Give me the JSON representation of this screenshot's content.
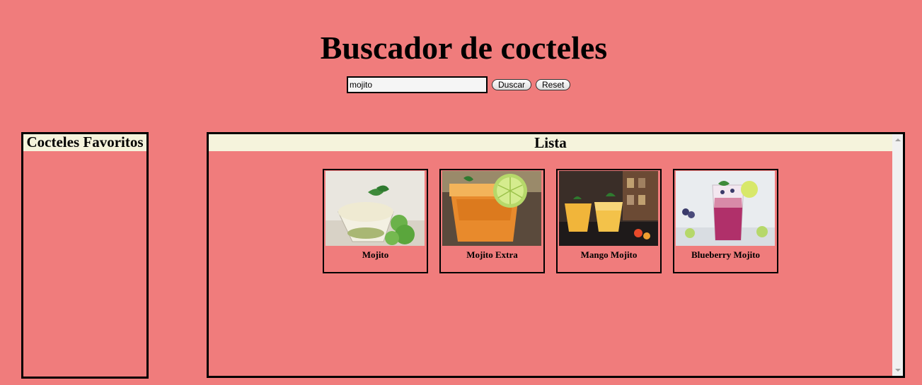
{
  "title": "Buscador de cocteles",
  "search": {
    "value": "mojito",
    "button_search": "Duscar",
    "button_reset": "Reset"
  },
  "favorites": {
    "header": "Cocteles Favoritos"
  },
  "list": {
    "header": "Lista",
    "items": [
      {
        "name": "Mojito"
      },
      {
        "name": "Mojito Extra"
      },
      {
        "name": "Mango Mojito"
      },
      {
        "name": "Blueberry Mojito"
      }
    ]
  }
}
